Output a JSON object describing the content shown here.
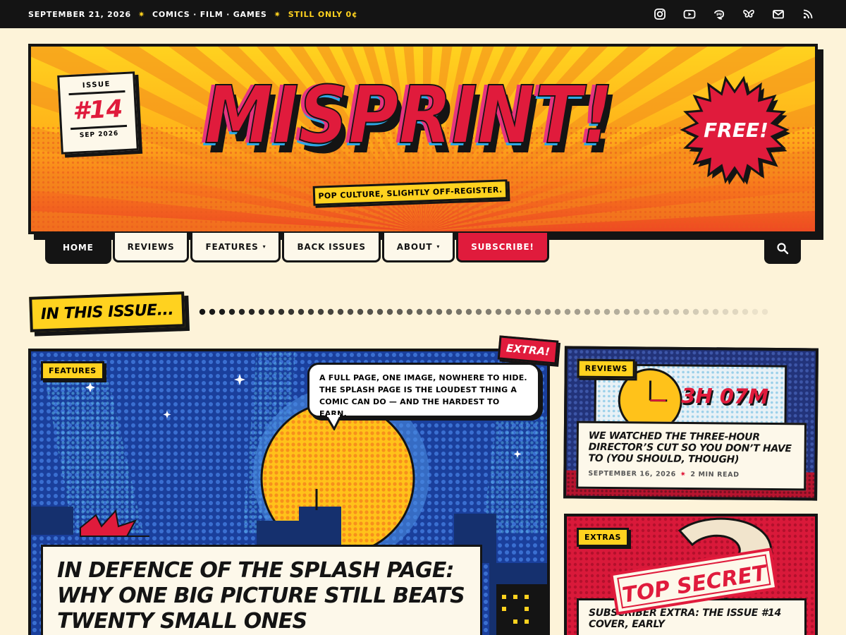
{
  "topbar": {
    "date": "SEPTEMBER 21, 2026",
    "sections": "COMICS · FILM · GAMES",
    "price": "STILL ONLY 0¢",
    "separator": "✷",
    "social_icons": [
      "instagram-icon",
      "youtube-icon",
      "mastodon-icon",
      "bluesky-icon",
      "email-icon",
      "rss-icon"
    ]
  },
  "masthead": {
    "logo": "MISPRINT!",
    "issue_label": "ISSUE",
    "issue_number": "#14",
    "issue_date": "SEP 2026",
    "free_badge": "FREE!",
    "tagline": "POP CULTURE, SLIGHTLY OFF-REGISTER."
  },
  "nav": {
    "items": [
      {
        "label": "HOME"
      },
      {
        "label": "REVIEWS"
      },
      {
        "label": "FEATURES",
        "caret": "▾"
      },
      {
        "label": "BACK ISSUES"
      },
      {
        "label": "ABOUT",
        "caret": "▾"
      },
      {
        "label": "SUBSCRIBE!"
      }
    ],
    "search_icon": "search-icon"
  },
  "section_title": "IN THIS ISSUE...",
  "feature": {
    "tag": "FEATURES",
    "extra_badge": "EXTRA!",
    "bubble": "A FULL PAGE, ONE IMAGE, NOWHERE TO HIDE. THE SPLASH PAGE IS THE LOUDEST THING A COMIC CAN DO — AND THE HARDEST TO EARN.",
    "headline": "IN DEFENCE OF THE SPLASH PAGE: WHY ONE BIG PICTURE STILL BEATS TWENTY SMALL ONES"
  },
  "cards": [
    {
      "tag": "REVIEWS",
      "art_text": "3H 07M",
      "title": "WE WATCHED THE THREE-HOUR DIRECTOR’S CUT SO YOU DON’T HAVE TO (YOU SHOULD, THOUGH)",
      "date": "SEPTEMBER 16, 2026",
      "read": "2 MIN READ"
    },
    {
      "tag": "EXTRAS",
      "stamp": "TOP SECRET",
      "title": "SUBSCRIBER EXTRA: THE ISSUE #14 COVER, EARLY"
    }
  ],
  "colors": {
    "ink": "#141414",
    "paper": "#fdf3d9",
    "yellow": "#ffd21f",
    "red": "#e01b3c",
    "blue": "#173f9a"
  }
}
